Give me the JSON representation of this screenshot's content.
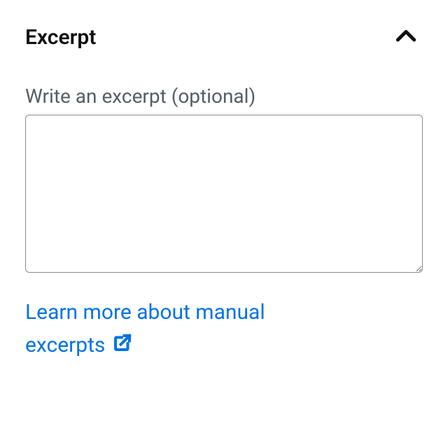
{
  "panel": {
    "title": "Excerpt",
    "collapsed": false
  },
  "field": {
    "label": "Write an excerpt (optional)",
    "value": ""
  },
  "help_link": {
    "text": "Learn more about manual excerpts"
  },
  "icons": {
    "toggle": "chevron-up-icon",
    "external": "external-link-icon"
  }
}
